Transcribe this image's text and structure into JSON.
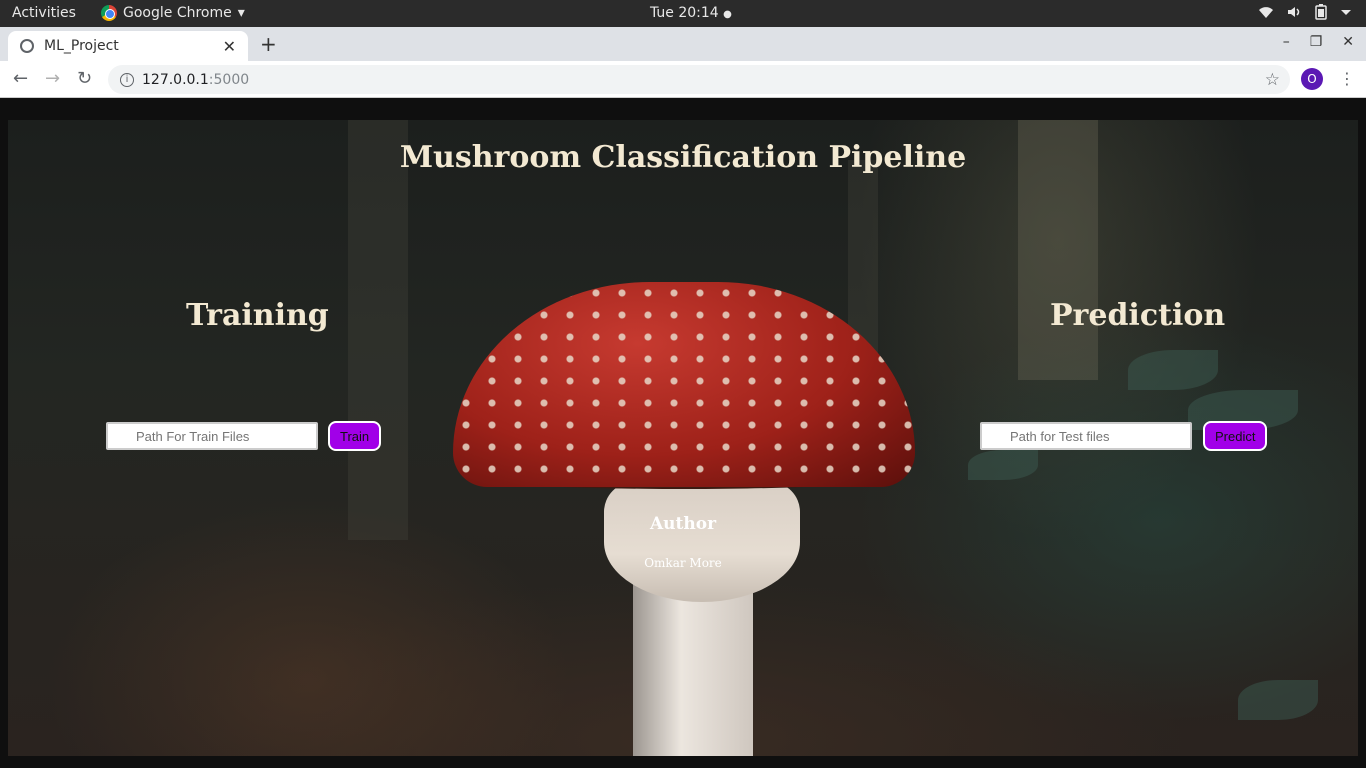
{
  "os_bar": {
    "activities": "Activities",
    "app_name": "Google Chrome",
    "app_menu_glyph": "▾",
    "clock": "Tue 20:14",
    "clock_dot": "●",
    "tray_icons": [
      "wifi-icon",
      "volume-icon",
      "battery-icon",
      "system-menu-icon"
    ]
  },
  "browser": {
    "tab_title": "ML_Project",
    "tab_close": "✕",
    "new_tab": "+",
    "window_minimize": "–",
    "window_maximize": "❐",
    "window_close": "✕",
    "back": "←",
    "forward": "→",
    "reload": "↻",
    "url_host": "127.0.0.1",
    "url_port": ":5000",
    "bookmark_star": "☆",
    "profile_initial": "O",
    "menu": "⋮"
  },
  "page": {
    "title": "Mushroom Classification Pipeline",
    "training": {
      "heading": "Training",
      "input_placeholder": "Path For Train Files",
      "button_label": "Train"
    },
    "prediction": {
      "heading": "Prediction",
      "input_placeholder": "Path for Test files",
      "button_label": "Predict"
    },
    "author": {
      "heading": "Author",
      "name": "Omkar More"
    }
  },
  "colors": {
    "button_bg": "#a100e8",
    "heading_text": "#f3e9d2",
    "profile_avatar": "#5b18b4"
  }
}
